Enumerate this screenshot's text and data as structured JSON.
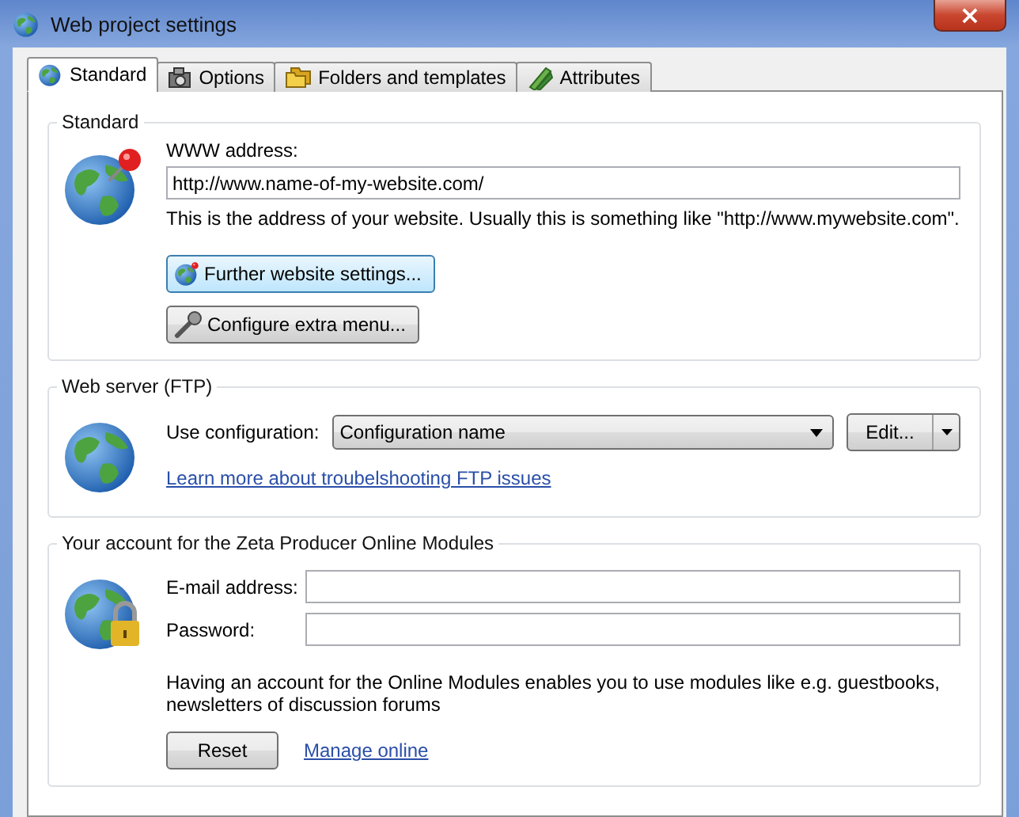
{
  "window": {
    "title": "Web project settings",
    "close_label": "×"
  },
  "tabs": [
    {
      "label": "Standard",
      "selected": true
    },
    {
      "label": "Options",
      "selected": false
    },
    {
      "label": "Folders and templates",
      "selected": false
    },
    {
      "label": "Attributes",
      "selected": false
    }
  ],
  "standard": {
    "title": "Standard",
    "address_label": "WWW address:",
    "address_value": "http://www.name-of-my-website.com/",
    "hint": "This is the address of your website. Usually this is something like \"http://www.mywebsite.com\".",
    "buttons": [
      {
        "label": "Further website settings...",
        "focused": true
      },
      {
        "label": "Configure extra menu...",
        "focused": false
      }
    ]
  },
  "web_server": {
    "title": "Web server (FTP)",
    "config_label": "Use configuration:",
    "config_value": "Configuration name",
    "edit_button": "Edit...",
    "link": "Learn more about troubelshooting FTP issues"
  },
  "account": {
    "title": "Your account for the Zeta Producer Online Modules",
    "email_label": "E-mail address:",
    "password_label": "Password:",
    "note": "Having an account for the Online Modules enables you to use modules like e.g. guestbooks, newsletters of discussion forums",
    "reset_button": "Reset",
    "link": "Manage online"
  }
}
